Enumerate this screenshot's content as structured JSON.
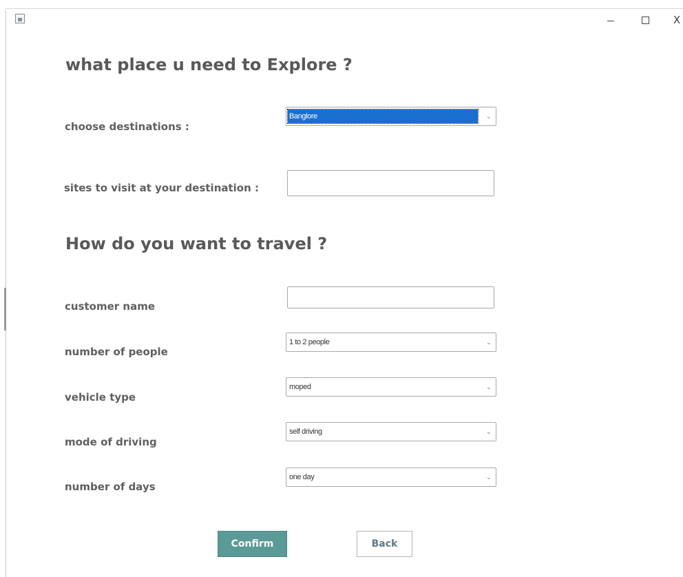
{
  "window": {
    "controls": {
      "minimize": "–",
      "maximize": "□",
      "close": "X"
    }
  },
  "headings": {
    "explore": "what place u need to Explore ?",
    "travel": "How do you want to travel ?"
  },
  "form": {
    "destination": {
      "label": "choose destinations :",
      "selected": "Banglore"
    },
    "sites": {
      "label": "sites to visit at your destination :",
      "value": ""
    },
    "customer_name": {
      "label": "customer name",
      "value": ""
    },
    "people": {
      "label": "number of people",
      "selected": "1 to 2 people"
    },
    "vehicle": {
      "label": "vehicle type",
      "selected": "moped"
    },
    "mode": {
      "label": "mode of driving",
      "selected": "self driving"
    },
    "days": {
      "label": "number of days",
      "selected": "one day"
    }
  },
  "buttons": {
    "confirm": "Confirm",
    "back": "Back"
  },
  "icons": {
    "app": "java-app-icon",
    "dropdown": "chevron-down-icon"
  },
  "colors": {
    "confirm_bg": "#5a9a97",
    "selection_bg": "#1a6fd0",
    "text": "#5f5f5f"
  }
}
